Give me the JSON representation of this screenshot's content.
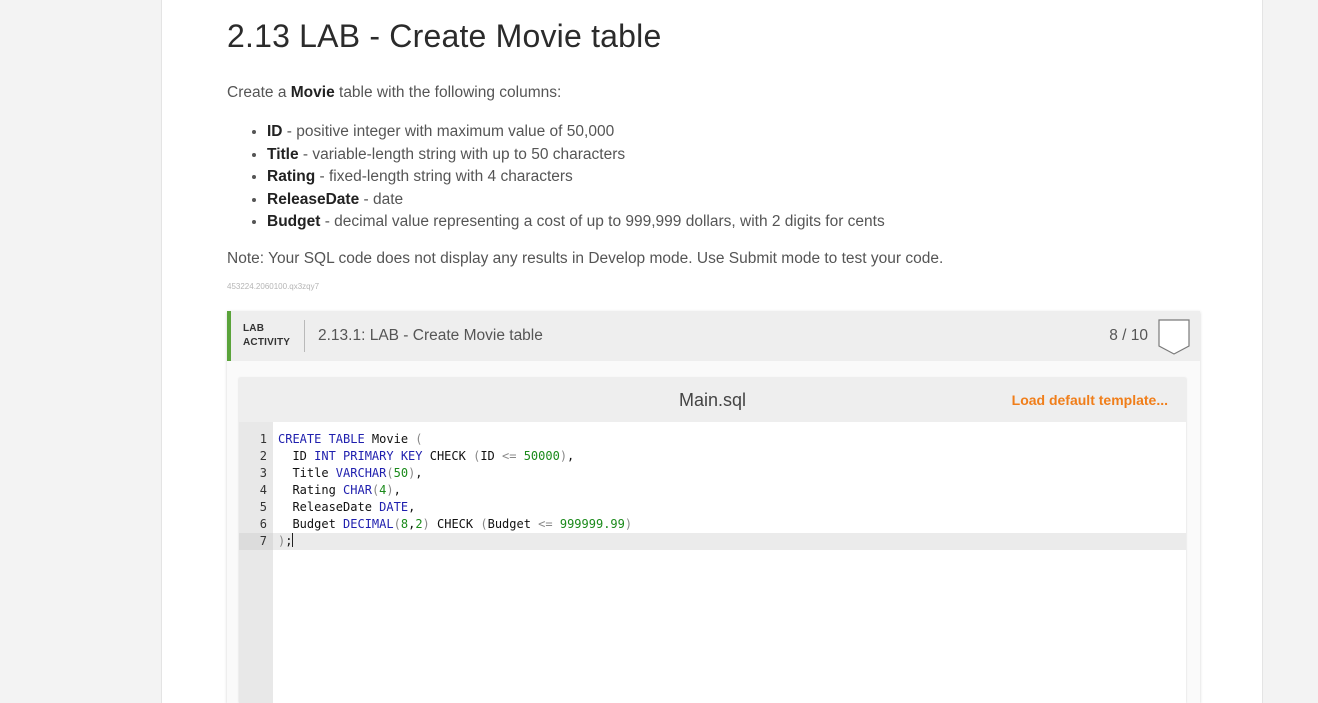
{
  "page": {
    "title": "2.13 LAB - Create Movie table",
    "intro": {
      "before": "Create a ",
      "bold": "Movie",
      "after": " table with the following columns:"
    },
    "columns": [
      {
        "name": "ID",
        "desc": " - positive integer with maximum value of 50,000"
      },
      {
        "name": "Title",
        "desc": " - variable-length string with up to 50 characters"
      },
      {
        "name": "Rating",
        "desc": " - fixed-length string with 4 characters"
      },
      {
        "name": "ReleaseDate",
        "desc": " - date"
      },
      {
        "name": "Budget",
        "desc": " - decimal value representing a cost of up to 999,999 dollars, with 2 digits for cents"
      }
    ],
    "note": "Note: Your SQL code does not display any results in Develop mode. Use Submit mode to test your code.",
    "ref_id": "453224.2060100.qx3zqy7"
  },
  "lab": {
    "tag_line1": "LAB",
    "tag_line2": "ACTIVITY",
    "title": "2.13.1: LAB - Create Movie table",
    "score": "8 / 10",
    "accent_color": "#5aa33a"
  },
  "editor": {
    "file_name": "Main.sql",
    "load_template_label": "Load default template...",
    "active_line": 7,
    "lines": [
      {
        "num": "1",
        "tokens": [
          [
            "kw",
            "CREATE TABLE"
          ],
          [
            "t",
            " Movie "
          ],
          [
            "op",
            "("
          ]
        ]
      },
      {
        "num": "2",
        "tokens": [
          [
            "t",
            "  ID "
          ],
          [
            "kw",
            "INT PRIMARY KEY"
          ],
          [
            "t",
            " CHECK "
          ],
          [
            "op",
            "("
          ],
          [
            "t",
            "ID "
          ],
          [
            "op",
            "<="
          ],
          [
            "t",
            " "
          ],
          [
            "num",
            "50000"
          ],
          [
            "op",
            ")"
          ],
          [
            "t",
            ","
          ]
        ]
      },
      {
        "num": "3",
        "tokens": [
          [
            "t",
            "  Title "
          ],
          [
            "kw",
            "VARCHAR"
          ],
          [
            "op",
            "("
          ],
          [
            "num",
            "50"
          ],
          [
            "op",
            ")"
          ],
          [
            "t",
            ","
          ]
        ]
      },
      {
        "num": "4",
        "tokens": [
          [
            "t",
            "  Rating "
          ],
          [
            "kw",
            "CHAR"
          ],
          [
            "op",
            "("
          ],
          [
            "num",
            "4"
          ],
          [
            "op",
            ")"
          ],
          [
            "t",
            ","
          ]
        ]
      },
      {
        "num": "5",
        "tokens": [
          [
            "t",
            "  ReleaseDate "
          ],
          [
            "kw",
            "DATE"
          ],
          [
            "t",
            ","
          ]
        ]
      },
      {
        "num": "6",
        "tokens": [
          [
            "t",
            "  Budget "
          ],
          [
            "kw",
            "DECIMAL"
          ],
          [
            "op",
            "("
          ],
          [
            "num",
            "8"
          ],
          [
            "t",
            ","
          ],
          [
            "num",
            "2"
          ],
          [
            "op",
            ")"
          ],
          [
            "t",
            " CHECK "
          ],
          [
            "op",
            "("
          ],
          [
            "t",
            "Budget "
          ],
          [
            "op",
            "<="
          ],
          [
            "t",
            " "
          ],
          [
            "num",
            "999999.99"
          ],
          [
            "op",
            ")"
          ]
        ]
      },
      {
        "num": "7",
        "tokens": [
          [
            "op",
            ")"
          ],
          [
            "t",
            ";"
          ]
        ]
      }
    ]
  }
}
